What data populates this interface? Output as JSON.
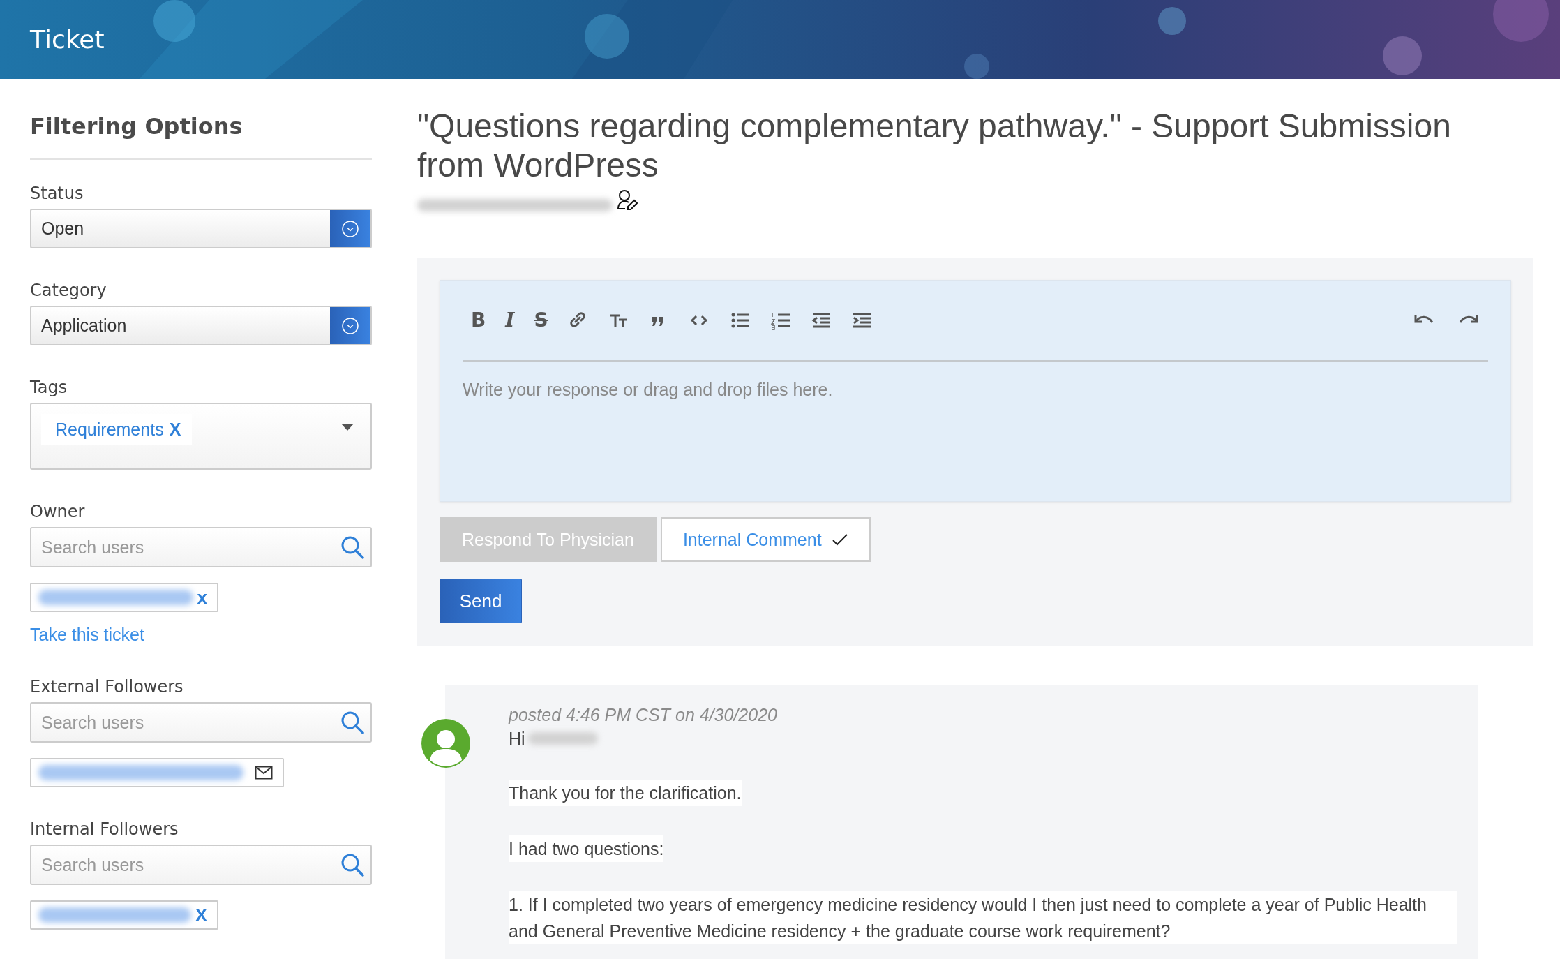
{
  "header": {
    "title": "Ticket"
  },
  "sidebar": {
    "heading": "Filtering Options",
    "sections": [
      {
        "kind": "select",
        "label": "Status",
        "value": "Open"
      },
      {
        "kind": "select",
        "label": "Category",
        "value": "Application"
      },
      {
        "kind": "tags",
        "label": "Tags",
        "tags": [
          {
            "label": "Requirements",
            "remove": "X"
          }
        ]
      },
      {
        "kind": "user_search",
        "label": "Owner",
        "placeholder": "Search users",
        "chips": [
          {
            "kind": "removable",
            "remove": "x"
          }
        ],
        "link": "Take this ticket"
      },
      {
        "kind": "user_search",
        "label": "External Followers",
        "placeholder": "Search users",
        "chips": [
          {
            "kind": "email"
          }
        ]
      },
      {
        "kind": "user_search",
        "label": "Internal Followers",
        "placeholder": "Search users",
        "chips": [
          {
            "kind": "removable",
            "remove": "X"
          }
        ]
      }
    ]
  },
  "ticket": {
    "title": "\"Questions regarding complementary pathway.\" - Support Submission from WordPress"
  },
  "editor": {
    "toolbar": [
      {
        "kind": "bold",
        "glyph": "B"
      },
      {
        "kind": "italic",
        "glyph": "I"
      },
      {
        "kind": "strike",
        "glyph": "S"
      },
      {
        "kind": "link"
      },
      {
        "kind": "heading"
      },
      {
        "kind": "quote"
      },
      {
        "kind": "code"
      },
      {
        "kind": "bullets"
      },
      {
        "kind": "numbers"
      },
      {
        "kind": "outdent"
      },
      {
        "kind": "indent"
      }
    ],
    "history": [
      {
        "kind": "undo"
      },
      {
        "kind": "redo"
      }
    ],
    "placeholder": "Write your response or drag and drop files here.",
    "modes": [
      {
        "label": "Respond To Physician",
        "selected": false
      },
      {
        "label": "Internal Comment",
        "selected": true
      }
    ],
    "send": "Send"
  },
  "messages": [
    {
      "posted": "posted 4:46 PM CST on 4/30/2020",
      "greeting": "Hi",
      "paragraphs": [
        "Thank you for the clarification.",
        "I had two questions:",
        "1. If I completed two years of emergency medicine residency would I then just need to complete a year of Public Health and General Preventive Medicine residency + the graduate course work requirement?"
      ]
    }
  ]
}
